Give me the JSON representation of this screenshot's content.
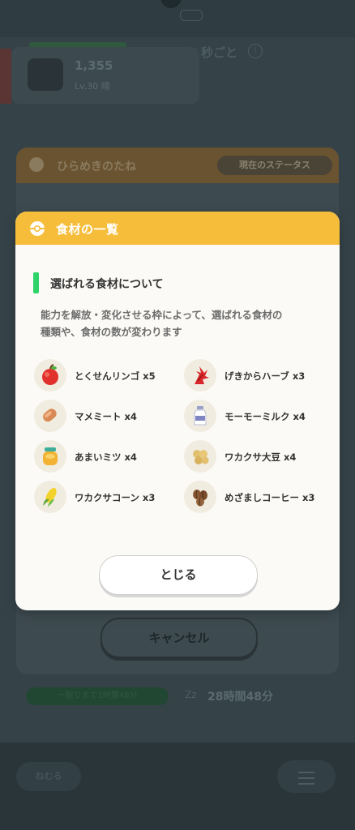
{
  "background": {
    "card_value": "1,355",
    "card_sub": "Lv.30 晴",
    "heading_fragment": "秒ごと",
    "modal_title": "ひらめきのたね",
    "status_button": "現在のステータス",
    "cancel_button": "キャンセル",
    "progress_label": "一眠りまで1時間48分",
    "sleep_time": "28時間48分",
    "bottom_left_label": "ねむる"
  },
  "dialog": {
    "title": "食材の一覧",
    "section_title": "選ばれる食材について",
    "description_lines": [
      "能力を解放・変化させる枠によって、選ばれる食材の",
      "種類や、食材の数が変わります"
    ],
    "ingredients": [
      {
        "label": "とくせんリンゴ x5",
        "icon": "apple-icon"
      },
      {
        "label": "げきからハーブ x3",
        "icon": "fiery-herb-icon"
      },
      {
        "label": "マメミート x4",
        "icon": "bean-sausage-icon"
      },
      {
        "label": "モーモーミルク x4",
        "icon": "milk-bottle-icon"
      },
      {
        "label": "あまいミツ x4",
        "icon": "honey-jar-icon"
      },
      {
        "label": "ワカクサ大豆 x4",
        "icon": "soybeans-icon"
      },
      {
        "label": "ワカクサコーン x3",
        "icon": "corn-icon"
      },
      {
        "label": "めざましコーヒー x3",
        "icon": "coffee-beans-icon"
      }
    ],
    "close_button": "とじる"
  },
  "colors": {
    "header": "#f6bd3a",
    "accent_bar": "#2ed36a",
    "dialog_bg": "#fbfaf6"
  }
}
